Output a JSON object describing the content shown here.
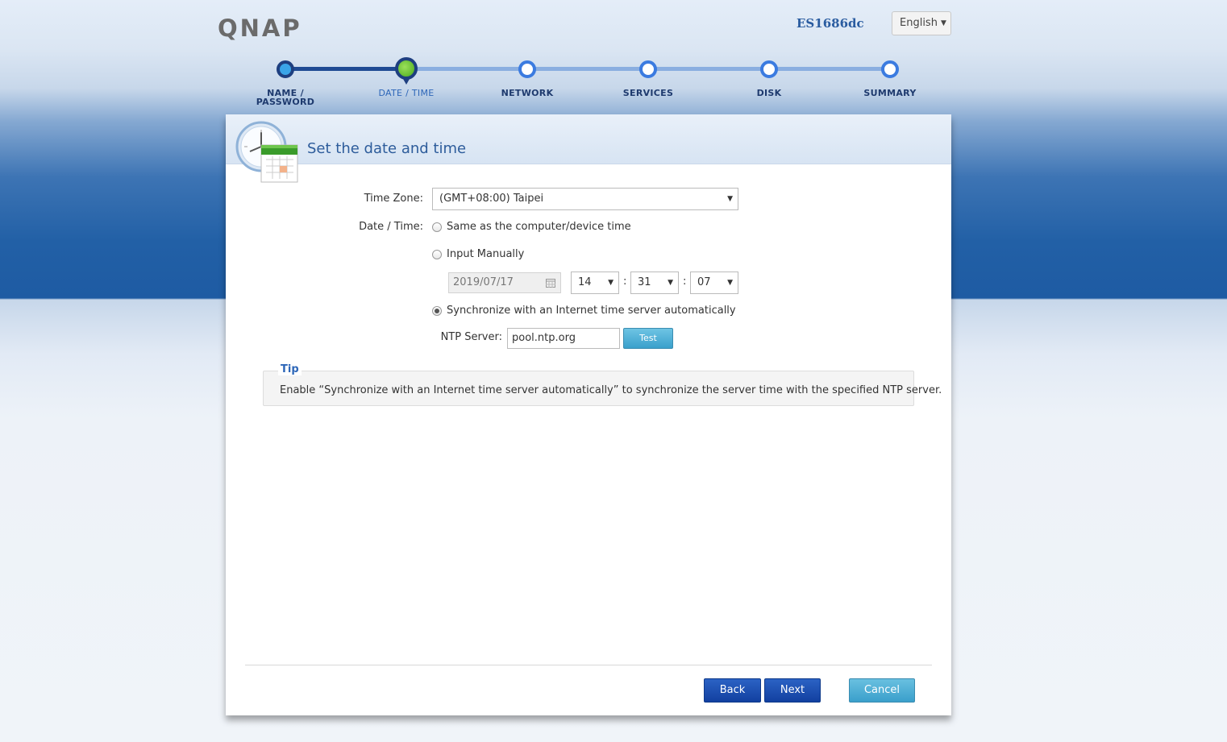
{
  "header": {
    "logo": "QNAP",
    "model": "ES1686dc",
    "language": "English"
  },
  "steps": [
    {
      "label": "NAME / PASSWORD",
      "state": "done"
    },
    {
      "label": "DATE / TIME",
      "state": "current"
    },
    {
      "label": "NETWORK",
      "state": "pending"
    },
    {
      "label": "SERVICES",
      "state": "pending"
    },
    {
      "label": "DISK",
      "state": "pending"
    },
    {
      "label": "SUMMARY",
      "state": "pending"
    }
  ],
  "panel": {
    "title": "Set the date and time",
    "timezone_label": "Time Zone:",
    "timezone_value": "(GMT+08:00) Taipei",
    "datetime_label": "Date / Time:",
    "option_same": "Same as the computer/device time",
    "option_manual": "Input Manually",
    "option_sync": "Synchronize with an Internet time server automatically",
    "selected_option": "sync",
    "date_value": "2019/07/17",
    "hour": "14",
    "minute": "31",
    "second": "07",
    "colon": ":",
    "ntp_label": "NTP Server:",
    "ntp_value": "pool.ntp.org",
    "test_button": "Test"
  },
  "tip": {
    "title": "Tip",
    "text": "Enable “Synchronize with an Internet time server automatically” to synchronize the server time with the specified NTP server."
  },
  "footer": {
    "back": "Back",
    "next": "Next",
    "cancel": "Cancel"
  },
  "colors": {
    "accent": "#2d66b8",
    "progress_done": "#1f4a93",
    "progress_pending": "#8aaee0",
    "primary_button": "#1240a0",
    "secondary_button": "#3a9fcb"
  },
  "icons": {
    "panel_icon": "clock-calendar-icon",
    "date_icon": "calendar-icon",
    "language_caret": "caret-down-icon"
  }
}
